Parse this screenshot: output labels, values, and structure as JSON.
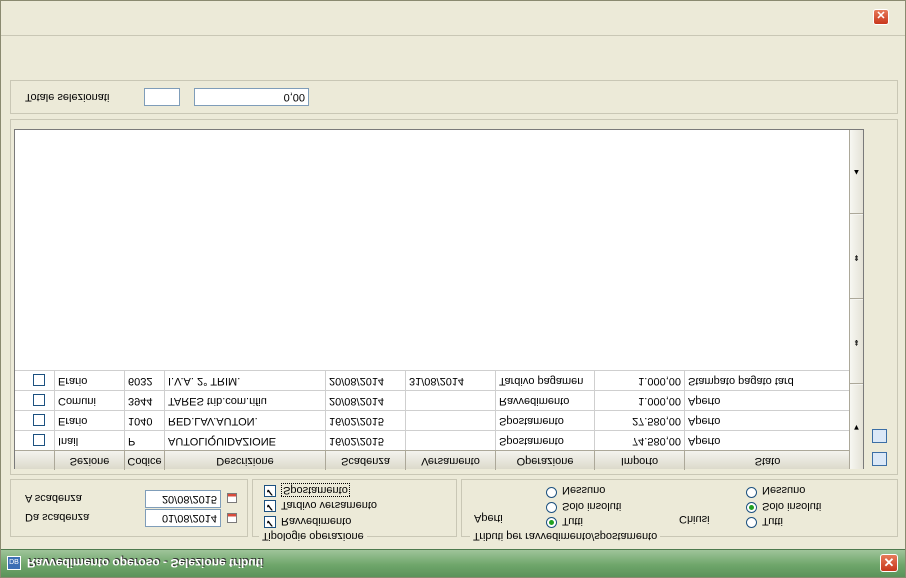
{
  "window": {
    "title": "Ravvedimento operoso - Selezione tributi",
    "app_icon_text": "DB",
    "close_glyph": "✕"
  },
  "scadenza": {
    "da_label": "Da scadenza",
    "da_value": "01/08/2014",
    "a_label": "A scadenza",
    "a_value": "20/08/2015"
  },
  "tipologie": {
    "legend": "Tipologie operazione",
    "items": [
      {
        "label": "Ravvedimento",
        "checked": true
      },
      {
        "label": "Tardivo versamento",
        "checked": true
      },
      {
        "label": "Spostamento",
        "checked": true
      }
    ]
  },
  "tributi": {
    "legend": "Tributi per ravvedimento/spostamento",
    "aperti_label": "Aperti",
    "chiusi_label": "Chiusi",
    "aperti_options": [
      {
        "label": "Tutti",
        "selected": true
      },
      {
        "label": "Solo insoluti",
        "selected": false
      },
      {
        "label": "Nessuno",
        "selected": false
      }
    ],
    "chiusi_options": [
      {
        "label": "Tutti",
        "selected": false
      },
      {
        "label": "Solo insoluti",
        "selected": true
      },
      {
        "label": "Nessuno",
        "selected": false
      }
    ]
  },
  "table": {
    "columns": [
      "Sezione",
      "Codice",
      "Descrizione",
      "Scadenza",
      "Versamento",
      "Operazione",
      "Importo",
      "Stato"
    ],
    "rows": [
      [
        "Inail",
        "P",
        "AUTOLIQUIDAZIONE",
        "16/02/2015",
        "",
        "Spostamento",
        "74.580,00",
        "Aperto"
      ],
      [
        "Erario",
        "1040",
        "RED.LAV.AUTON.",
        "16/02/2015",
        "",
        "Spostamento",
        "27.580,00",
        "Aperto"
      ],
      [
        "Comuni",
        "3944",
        "TARES trib.com.rifiu",
        "20/08/2014",
        "",
        "Ravvedimento",
        "1.000,00",
        "Aperto"
      ],
      [
        "Erario",
        "6032",
        "I.V.A. 2° TRIM.",
        "20/08/2014",
        "31/08/2014",
        "Tardivo pagamen",
        "1.000,00",
        "Stampato pagato tard"
      ]
    ]
  },
  "totale": {
    "label": "Totale selezionati",
    "count": "",
    "amount": "0,00"
  },
  "scroll": {
    "up": "▲",
    "down": "▼",
    "page_up": "⇞",
    "page_down": "⇟"
  }
}
